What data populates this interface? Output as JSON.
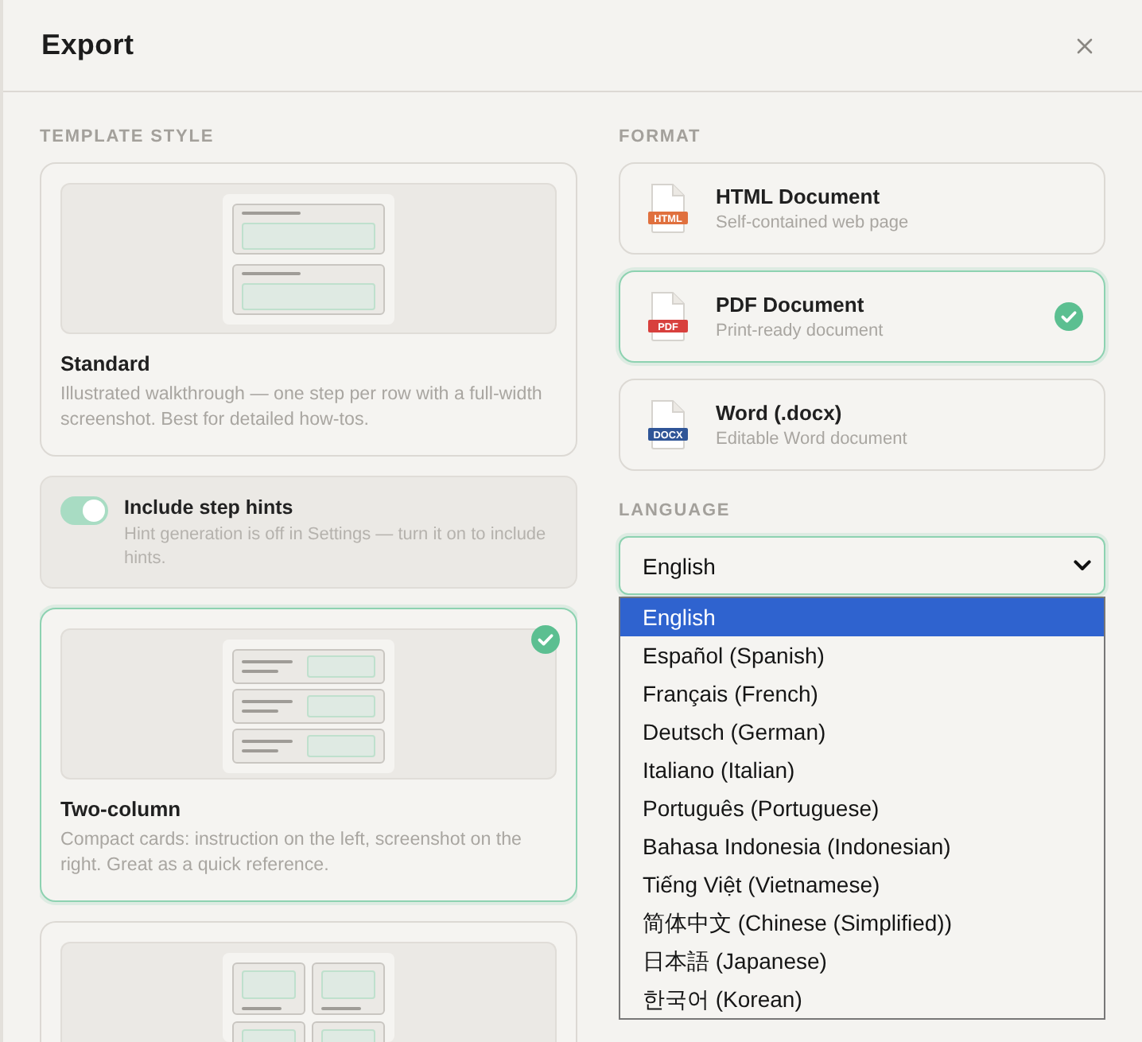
{
  "dialog": {
    "title": "Export"
  },
  "template_style": {
    "label": "TEMPLATE STYLE",
    "items": [
      {
        "kind": "template",
        "preview": {
          "kind": "rows"
        },
        "title": "Standard",
        "description": "Illustrated walkthrough — one step per row with a full-width screenshot. Best for detailed how-tos.",
        "selected": false
      },
      {
        "kind": "toggle",
        "title": "Include step hints",
        "description": "Hint generation is off in Settings — turn it on to include hints.",
        "on": true,
        "disabled": true
      },
      {
        "kind": "template",
        "preview": {
          "kind": "split"
        },
        "title": "Two-column",
        "description": "Compact cards: instruction on the left, screenshot on the right. Great as a quick reference.",
        "selected": true
      },
      {
        "kind": "template",
        "preview": {
          "kind": "grid"
        },
        "selected": false
      }
    ]
  },
  "format": {
    "label": "FORMAT",
    "options": [
      {
        "title": "HTML Document",
        "description": "Self-contained web page",
        "icon_label": "HTML",
        "color": "#e0703e",
        "selected": false
      },
      {
        "title": "PDF Document",
        "description": "Print-ready document",
        "icon_label": "PDF",
        "color": "#d8403d",
        "selected": true
      },
      {
        "title": "Word (.docx)",
        "description": "Editable Word document",
        "icon_label": "DOCX",
        "color": "#2f5597",
        "selected": false
      }
    ]
  },
  "language": {
    "label": "LANGUAGE",
    "value": "English",
    "options": [
      {
        "label": "English",
        "selected": true
      },
      {
        "label": "Español (Spanish)",
        "selected": false
      },
      {
        "label": "Français (French)",
        "selected": false
      },
      {
        "label": "Deutsch (German)",
        "selected": false
      },
      {
        "label": "Italiano (Italian)",
        "selected": false
      },
      {
        "label": "Português (Portuguese)",
        "selected": false
      },
      {
        "label": "Bahasa Indonesia (Indonesian)",
        "selected": false
      },
      {
        "label": "Tiếng Việt (Vietnamese)",
        "selected": false
      },
      {
        "label": "简体中文 (Chinese (Simplified))",
        "selected": false
      },
      {
        "label": "日本語 (Japanese)",
        "selected": false
      },
      {
        "label": "한국어 (Korean)",
        "selected": false
      }
    ]
  }
}
